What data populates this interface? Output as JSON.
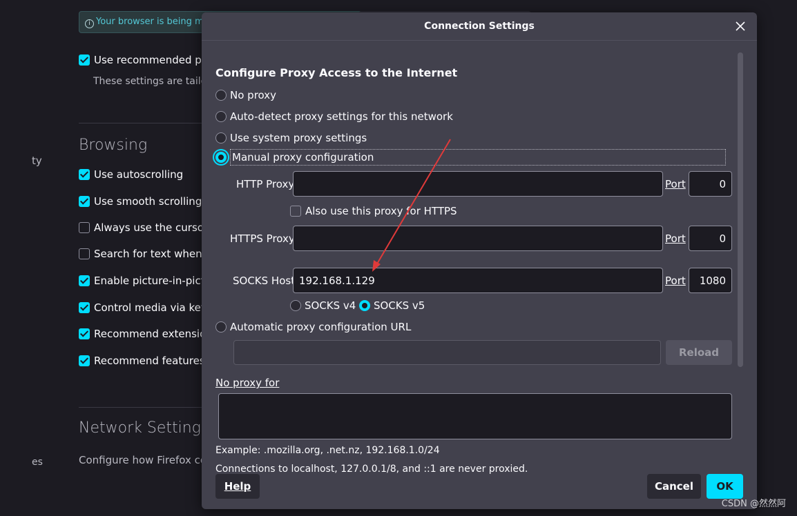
{
  "background": {
    "notice_text": "Your browser is being ma",
    "use_recommended": "Use recommended per",
    "use_recommended_sub": "These settings are tailore",
    "sidebar_fragment_1": "ty",
    "sidebar_fragment_2": "es",
    "browsing_heading": "Browsing",
    "options": [
      {
        "label": "Use autoscrolling",
        "checked": true
      },
      {
        "label": "Use smooth scrolling",
        "checked": true
      },
      {
        "label": "Always use the cursor",
        "checked": false
      },
      {
        "label": "Search for text when y",
        "checked": false
      },
      {
        "label": "Enable picture-in-pictu",
        "checked": true
      },
      {
        "label": "Control media via keyb",
        "checked": true
      },
      {
        "label": "Recommend extension",
        "checked": true
      },
      {
        "label": "Recommend features a",
        "checked": true
      }
    ],
    "network_heading": "Network Settings",
    "network_sub": "Configure how Firefox co"
  },
  "dialog": {
    "title": "Connection Settings",
    "section_title": "Configure Proxy Access to the Internet",
    "radio_no_proxy": "No proxy",
    "radio_auto_detect": "Auto-detect proxy settings for this network",
    "radio_system": "Use system proxy settings",
    "radio_manual": "Manual proxy configuration",
    "http_proxy_label": "HTTP Proxy",
    "http_proxy_value": "",
    "http_port_label": "Port",
    "http_port_value": "0",
    "also_https_label": "Also use this proxy for HTTPS",
    "https_proxy_label": "HTTPS Proxy",
    "https_proxy_value": "",
    "https_port_label": "Port",
    "https_port_value": "0",
    "socks_host_label": "SOCKS Host",
    "socks_host_value": "192.168.1.129",
    "socks_port_label": "Port",
    "socks_port_value": "1080",
    "socks_v4": "SOCKS v4",
    "socks_v5": "SOCKS v5",
    "radio_auto_url": "Automatic proxy configuration URL",
    "auto_url_value": "",
    "reload_button": "Reload",
    "no_proxy_label": "No proxy for",
    "no_proxy_value": "",
    "example_text": "Example: .mozilla.org, .net.nz, 192.168.1.0/24",
    "localhost_text": "Connections to localhost, 127.0.0.1/8, and ::1 are never proxied.",
    "help_button": "Help",
    "cancel_button": "Cancel",
    "ok_button": "OK"
  },
  "watermark": "CSDN @然然阿",
  "colors": {
    "accent": "#00ddff",
    "dialog_bg": "#42414d",
    "field_bg": "#1c1b22",
    "arrow": "#e03a3a"
  }
}
